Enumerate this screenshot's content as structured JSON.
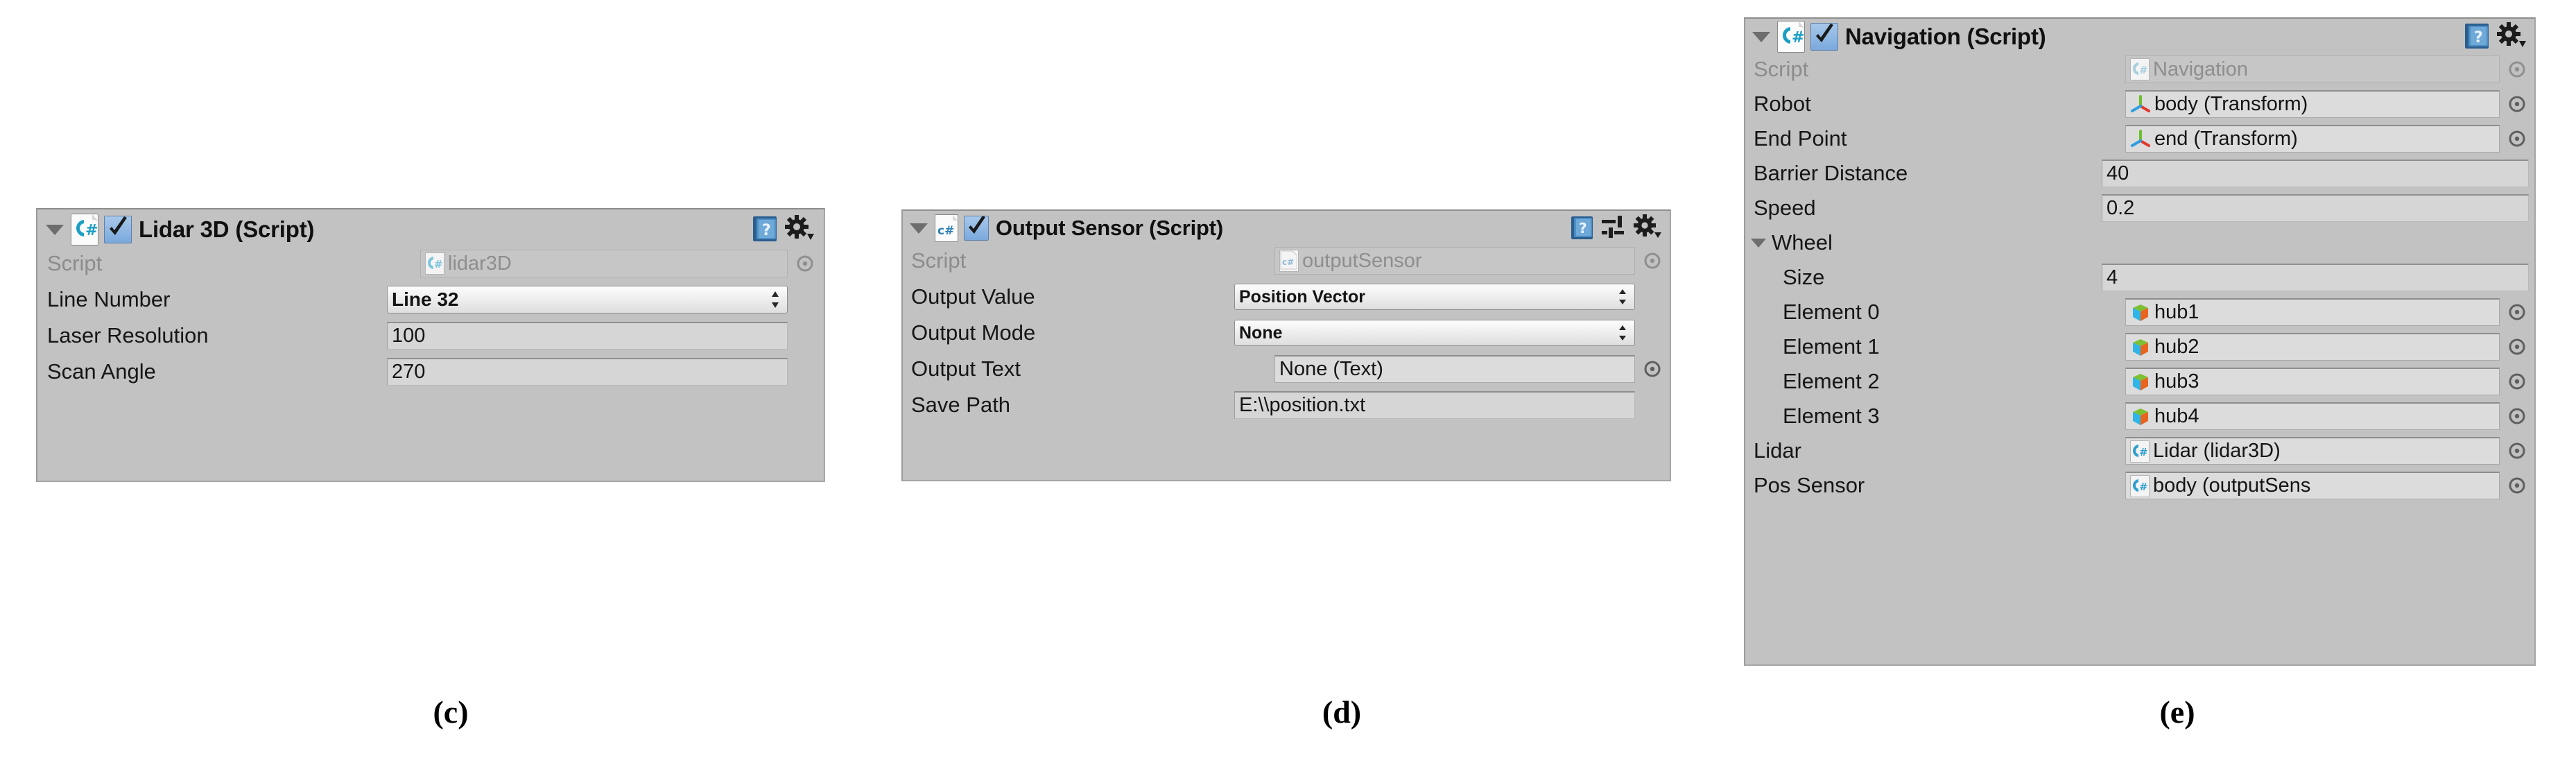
{
  "figure": {
    "captions": [
      {
        "id": "c",
        "text": "(c)"
      },
      {
        "id": "d",
        "text": "(d)"
      },
      {
        "id": "e",
        "text": "(e)"
      }
    ]
  },
  "colors": {
    "panel_background": "#c2c2c2",
    "field_background": "#d6d6d6",
    "readonly_text": "#8e8e8e",
    "label_text": "#161616",
    "checkbox_blue": "#7aa9dd",
    "script_icon_teal": "#1b9ec4",
    "axis_green": "#6fbf2f",
    "axis_red": "#e03a2f",
    "axis_blue": "#2f9fe0",
    "cube_green": "#7dbf32",
    "cube_cyan": "#2fb5e8",
    "cube_orange": "#e8651f"
  },
  "panels": [
    {
      "id": "lidar3d",
      "header": {
        "title": "Lidar 3D (Script)",
        "foldout_expanded": true,
        "enabled": true,
        "icons": [
          "csharp-script-icon",
          "enabled-checkbox",
          "help-icon",
          "gear-icon"
        ]
      },
      "rows": [
        {
          "label": "Script",
          "type": "object-readonly",
          "value": "lidar3D",
          "icon": "csharp-script-icon",
          "picker": true,
          "dim": true
        },
        {
          "label": "Line Number",
          "type": "popup",
          "value": "Line 32",
          "picker": false
        },
        {
          "label": "Laser Resolution",
          "type": "field",
          "value": "100",
          "picker": false
        },
        {
          "label": "Scan Angle",
          "type": "field",
          "value": "270",
          "picker": false
        }
      ]
    },
    {
      "id": "outputsensor",
      "header": {
        "title": "Output Sensor (Script)",
        "foldout_expanded": true,
        "enabled": true,
        "icons": [
          "csharp-script-icon",
          "enabled-checkbox",
          "help-icon",
          "preset-icon",
          "gear-icon"
        ]
      },
      "rows": [
        {
          "label": "Script",
          "type": "object-readonly",
          "value": "outputSensor",
          "icon": "csharp-script-icon",
          "picker": true,
          "dim": true
        },
        {
          "label": "Output Value",
          "type": "popup-small",
          "value": "Position Vector",
          "picker": false
        },
        {
          "label": "Output Mode",
          "type": "popup-small",
          "value": "None",
          "picker": false
        },
        {
          "label": "Output Text",
          "type": "object",
          "value": "None (Text)",
          "icon": "none",
          "picker": true
        },
        {
          "label": "Save Path",
          "type": "field",
          "value": "E:\\\\position.txt",
          "picker": false
        }
      ]
    },
    {
      "id": "navigation",
      "header": {
        "title": "Navigation (Script)",
        "foldout_expanded": true,
        "enabled": true,
        "icons": [
          "csharp-script-icon",
          "enabled-checkbox",
          "help-icon",
          "gear-icon"
        ]
      },
      "rows": [
        {
          "label": "Script",
          "type": "object-readonly",
          "value": "Navigation",
          "icon": "csharp-script-icon",
          "picker": true,
          "dim": true
        },
        {
          "label": "Robot",
          "type": "object",
          "value": "body (Transform)",
          "icon": "transform-icon",
          "picker": true
        },
        {
          "label": "End Point",
          "type": "object",
          "value": "end (Transform)",
          "icon": "transform-icon",
          "picker": true
        },
        {
          "label": "Barrier Distance",
          "type": "field",
          "value": "40",
          "picker": false
        },
        {
          "label": "Wheel",
          "type": "foldout",
          "value": "",
          "picker": false
        },
        {
          "label": "Size",
          "type": "field",
          "value": "4",
          "picker": false,
          "indent": true
        },
        {
          "label": "Element 0",
          "type": "object",
          "value": "hub1",
          "icon": "cube-icon",
          "picker": true,
          "indent": true
        },
        {
          "label": "Element 1",
          "type": "object",
          "value": "hub2",
          "icon": "cube-icon",
          "picker": true,
          "indent": true
        },
        {
          "label": "Element 2",
          "type": "object",
          "value": "hub3",
          "icon": "cube-icon",
          "picker": true,
          "indent": true
        },
        {
          "label": "Element 3",
          "type": "object",
          "value": "hub4",
          "icon": "cube-icon",
          "picker": true,
          "indent": true
        },
        {
          "label": "Lidar",
          "type": "object",
          "value": "Lidar (lidar3D)",
          "icon": "csharp-script-icon",
          "picker": true
        },
        {
          "label": "Pos Sensor",
          "type": "object",
          "value": "body (outputSens",
          "icon": "csharp-script-icon",
          "picker": true
        }
      ],
      "speed_row": {
        "label": "Speed",
        "value": "0.2"
      }
    }
  ]
}
